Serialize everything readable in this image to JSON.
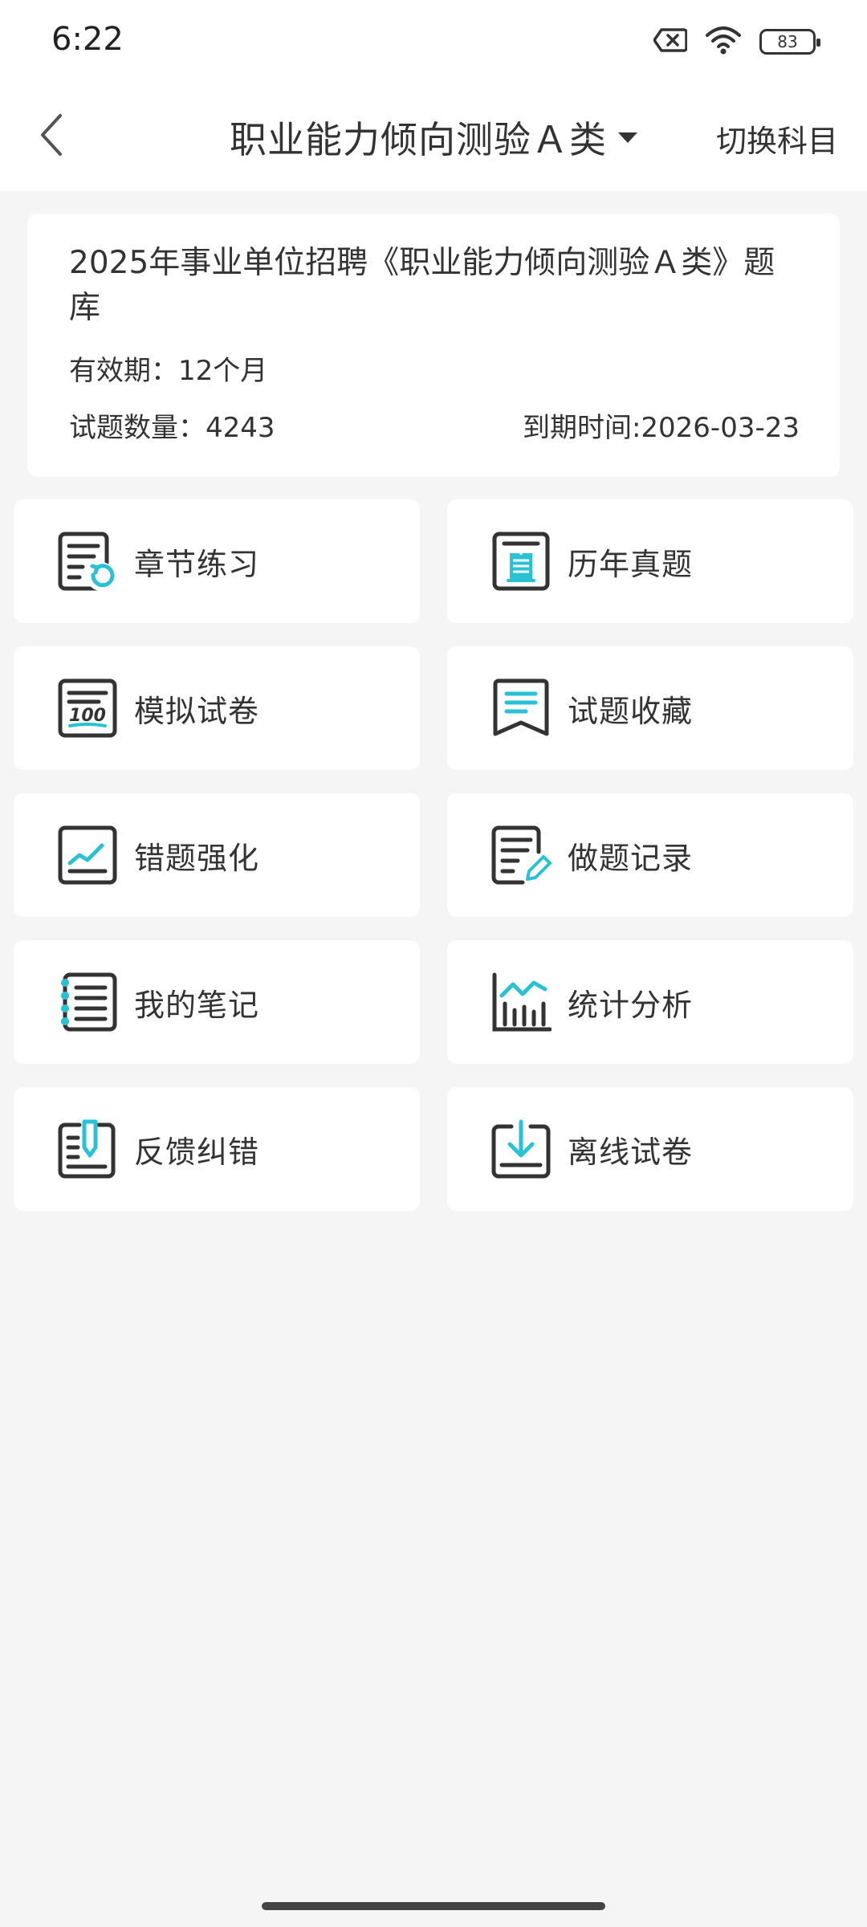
{
  "status_bar": {
    "time": "6:22",
    "battery": "83",
    "icons": [
      "sim-off-icon",
      "wifi-icon",
      "battery-icon"
    ]
  },
  "nav": {
    "back_icon": "chevron-left-icon",
    "title": "职业能力倾向测验Ａ类",
    "dropdown_icon": "caret-down-icon",
    "switch_label": "切换科目"
  },
  "info": {
    "bank_title": "2025年事业单位招聘《职业能力倾向测验Ａ类》题库",
    "validity": "有效期：12个月",
    "question_count": "试题数量：4243",
    "expiry": "到期时间:2026-03-23"
  },
  "features": [
    {
      "label": "章节练习",
      "icon": "chapter-practice-icon"
    },
    {
      "label": "历年真题",
      "icon": "past-exams-icon"
    },
    {
      "label": "模拟试卷",
      "icon": "mock-paper-icon"
    },
    {
      "label": "试题收藏",
      "icon": "bookmark-icon"
    },
    {
      "label": "错题强化",
      "icon": "wrong-questions-icon"
    },
    {
      "label": "做题记录",
      "icon": "practice-record-icon"
    },
    {
      "label": "我的笔记",
      "icon": "notebook-icon"
    },
    {
      "label": "统计分析",
      "icon": "statistics-icon"
    },
    {
      "label": "反馈纠错",
      "icon": "feedback-icon"
    },
    {
      "label": "离线试卷",
      "icon": "download-icon"
    }
  ],
  "colors": {
    "accent": "#29c1d6",
    "icon_dark": "#333333",
    "background": "#f5f5f5",
    "card": "#ffffff"
  }
}
